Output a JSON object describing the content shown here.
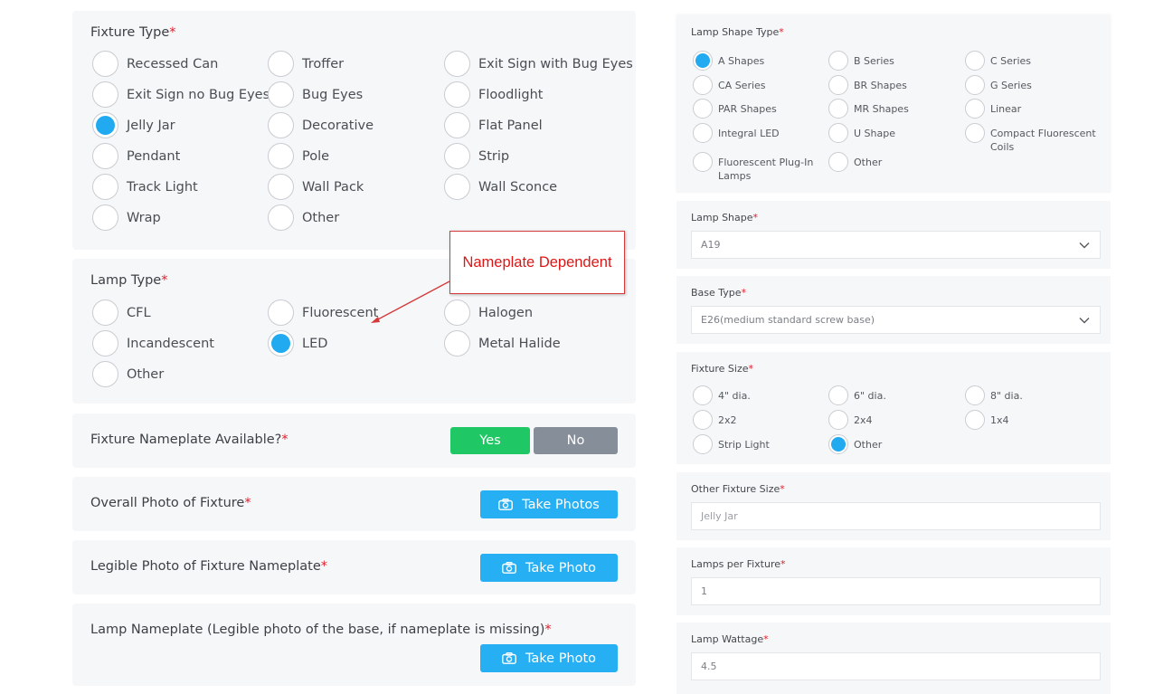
{
  "required_mark": "*",
  "fixture_type": {
    "label": "Fixture Type",
    "options": [
      "Recessed Can",
      "Troffer",
      "Exit Sign with Bug Eyes",
      "Exit Sign no Bug Eyes",
      "Bug Eyes",
      "Floodlight",
      "Jelly Jar",
      "Decorative",
      "Flat Panel",
      "Pendant",
      "Pole",
      "Strip",
      "Track Light",
      "Wall Pack",
      "Wall Sconce",
      "Wrap",
      "Other"
    ],
    "selected": "Jelly Jar"
  },
  "lamp_type": {
    "label": "Lamp Type",
    "options": [
      "CFL",
      "Fluorescent",
      "Halogen",
      "Incandescent",
      "LED",
      "Metal Halide",
      "Other"
    ],
    "selected": "LED"
  },
  "callout": {
    "text": "Nameplate Dependent",
    "color": "#e01515"
  },
  "nameplate": {
    "label": "Fixture Nameplate Available?",
    "yes": "Yes",
    "no": "No"
  },
  "overall_photo": {
    "label": "Overall Photo of Fixture",
    "button": "Take Photos"
  },
  "legible_photo": {
    "label": "Legible Photo of Fixture Nameplate",
    "button": "Take Photo"
  },
  "lamp_nameplate": {
    "label": "Lamp Nameplate (Legible photo of the base, if nameplate is missing)",
    "button": "Take Photo"
  },
  "lamp_shape_type": {
    "label": "Lamp Shape Type",
    "options": [
      "A Shapes",
      "B Series",
      "C Series",
      "CA Series",
      "BR Shapes",
      "G Series",
      "PAR Shapes",
      "MR Shapes",
      "Linear",
      "Integral LED",
      "U Shape",
      "Compact Fluorescent Coils",
      "Fluorescent Plug-In Lamps",
      "Other"
    ],
    "selected": "A Shapes"
  },
  "lamp_shape": {
    "label": "Lamp Shape",
    "value": "A19"
  },
  "base_type": {
    "label": "Base Type",
    "value": "E26(medium standard screw base)"
  },
  "fixture_size": {
    "label": "Fixture Size",
    "options": [
      "4\" dia.",
      "6\" dia.",
      "8\" dia.",
      "2x2",
      "2x4",
      "1x4",
      "Strip Light",
      "Other"
    ],
    "selected": "Other"
  },
  "other_fixture_size": {
    "label": "Other Fixture Size",
    "placeholder": "Jelly Jar"
  },
  "lamps_per_fixture": {
    "label": "Lamps per Fixture",
    "value": "1"
  },
  "lamp_wattage": {
    "label": "Lamp Wattage",
    "value": "4.5"
  },
  "icons": {
    "camera": "camera-icon",
    "chevron": "chevron-down-icon"
  },
  "colors": {
    "accent": "#22aaf0",
    "yes_button": "#1fc864",
    "no_button": "#868e99",
    "required": "#e11d2a",
    "photo_button": "#26aff2"
  }
}
